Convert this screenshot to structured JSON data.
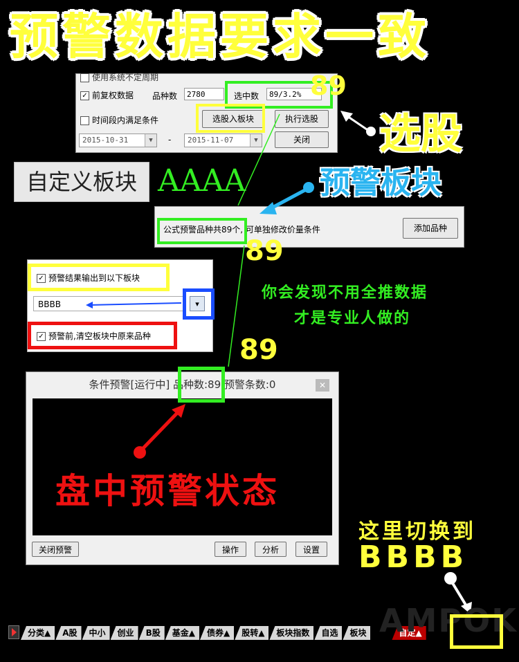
{
  "title": "预警数据要求一致",
  "screener": {
    "row0": "使用系统不定周期",
    "fuquan_label": "前复权数据",
    "pinzhong_label": "品种数",
    "pinzhong_value": "2780",
    "xuanzhong_label": "选中数",
    "xuanzhong_value": "89/3.2%",
    "shijianduan_label": "时间段内满足条件",
    "select_to_block_button": "选股入板块",
    "execute_button": "执行选股",
    "start_date": "2015-10-31",
    "dash": "-",
    "end_date": "2015-11-07",
    "close_button": "关闭",
    "count_note": "89"
  },
  "custom_block": {
    "label": "自定义板块",
    "name": "AAAA"
  },
  "annotations": {
    "xuangu": "选股",
    "yujing_bankuai": "预警板块",
    "count_2": "89",
    "count_3": "89",
    "green_note_line1": "你会发现不用全推数据",
    "green_note_line2": "才是专业人做的",
    "pan_zhong": "盘中预警状态",
    "switch_line1": "这里切换到",
    "switch_line2": "BBBB"
  },
  "formula_panel": {
    "text": "公式预警品种共89个, 可单独修改价量条件",
    "add_button": "添加品种"
  },
  "output_panel": {
    "output_checkbox_label": "预警结果输出到以下板块",
    "block_value": "BBBB",
    "clear_checkbox_label": "预警前,清空板块中原来品种"
  },
  "alert_window": {
    "title_prefix": "条件预警[运行中] 品种数:89 预警条数:0",
    "close_alert_button": "关闭预警",
    "operate_button": "操作",
    "analyze_button": "分析",
    "settings_button": "设置"
  },
  "tabs": [
    "分类▲",
    "A股",
    "中小",
    "创业",
    "B股",
    "基金▲",
    "债券▲",
    "股转▲",
    "板块指数",
    "自选",
    "板块",
    "自定▲"
  ],
  "watermark": "AMPOK",
  "colors": {
    "yellow": "#ffff3c",
    "green": "#33ee22",
    "red": "#ee1111",
    "blue": "#1a4dff",
    "cyan": "#2ab4f0"
  }
}
